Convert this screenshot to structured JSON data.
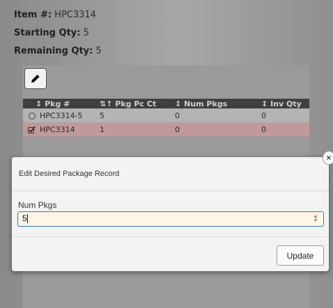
{
  "info": {
    "item_label": "Item #:",
    "item_value": "HPC3314",
    "start_label": "Starting Qty:",
    "start_value": "5",
    "remain_label": "Remaining Qty:",
    "remain_value": "5"
  },
  "grid": {
    "columns": [
      {
        "sort_glyph": "↕",
        "label": "Pkg #"
      },
      {
        "sort_glyph": "⇅↑",
        "label": "Pkg Pc Ct"
      },
      {
        "sort_glyph": "↕",
        "label": "Num Pkgs"
      },
      {
        "sort_glyph": "↕",
        "label": "Inv Qty"
      }
    ],
    "rows": [
      {
        "pkg": "HPC3314-5",
        "pc_ct": "5",
        "num_pkgs": "0",
        "inv_qty": "0",
        "selector": "radio-unchecked"
      },
      {
        "pkg": "HPC3314",
        "pc_ct": "1",
        "num_pkgs": "0",
        "inv_qty": "0",
        "selector": "checked"
      }
    ]
  },
  "modal": {
    "title": "Edit Desired Package Record",
    "field_label": "Num Pkgs",
    "field_value": "5",
    "update_label": "Update",
    "close_glyph": "×"
  },
  "icons": {
    "edit": "pencil-icon",
    "spinner": "spinner-arrows-icon",
    "close": "close-icon"
  },
  "colors": {
    "input_focus_border": "#3a73c8",
    "input_bg": "#fdf8e4",
    "selected_row": "#c09a9a",
    "header_bg": "#3f3f3f"
  }
}
